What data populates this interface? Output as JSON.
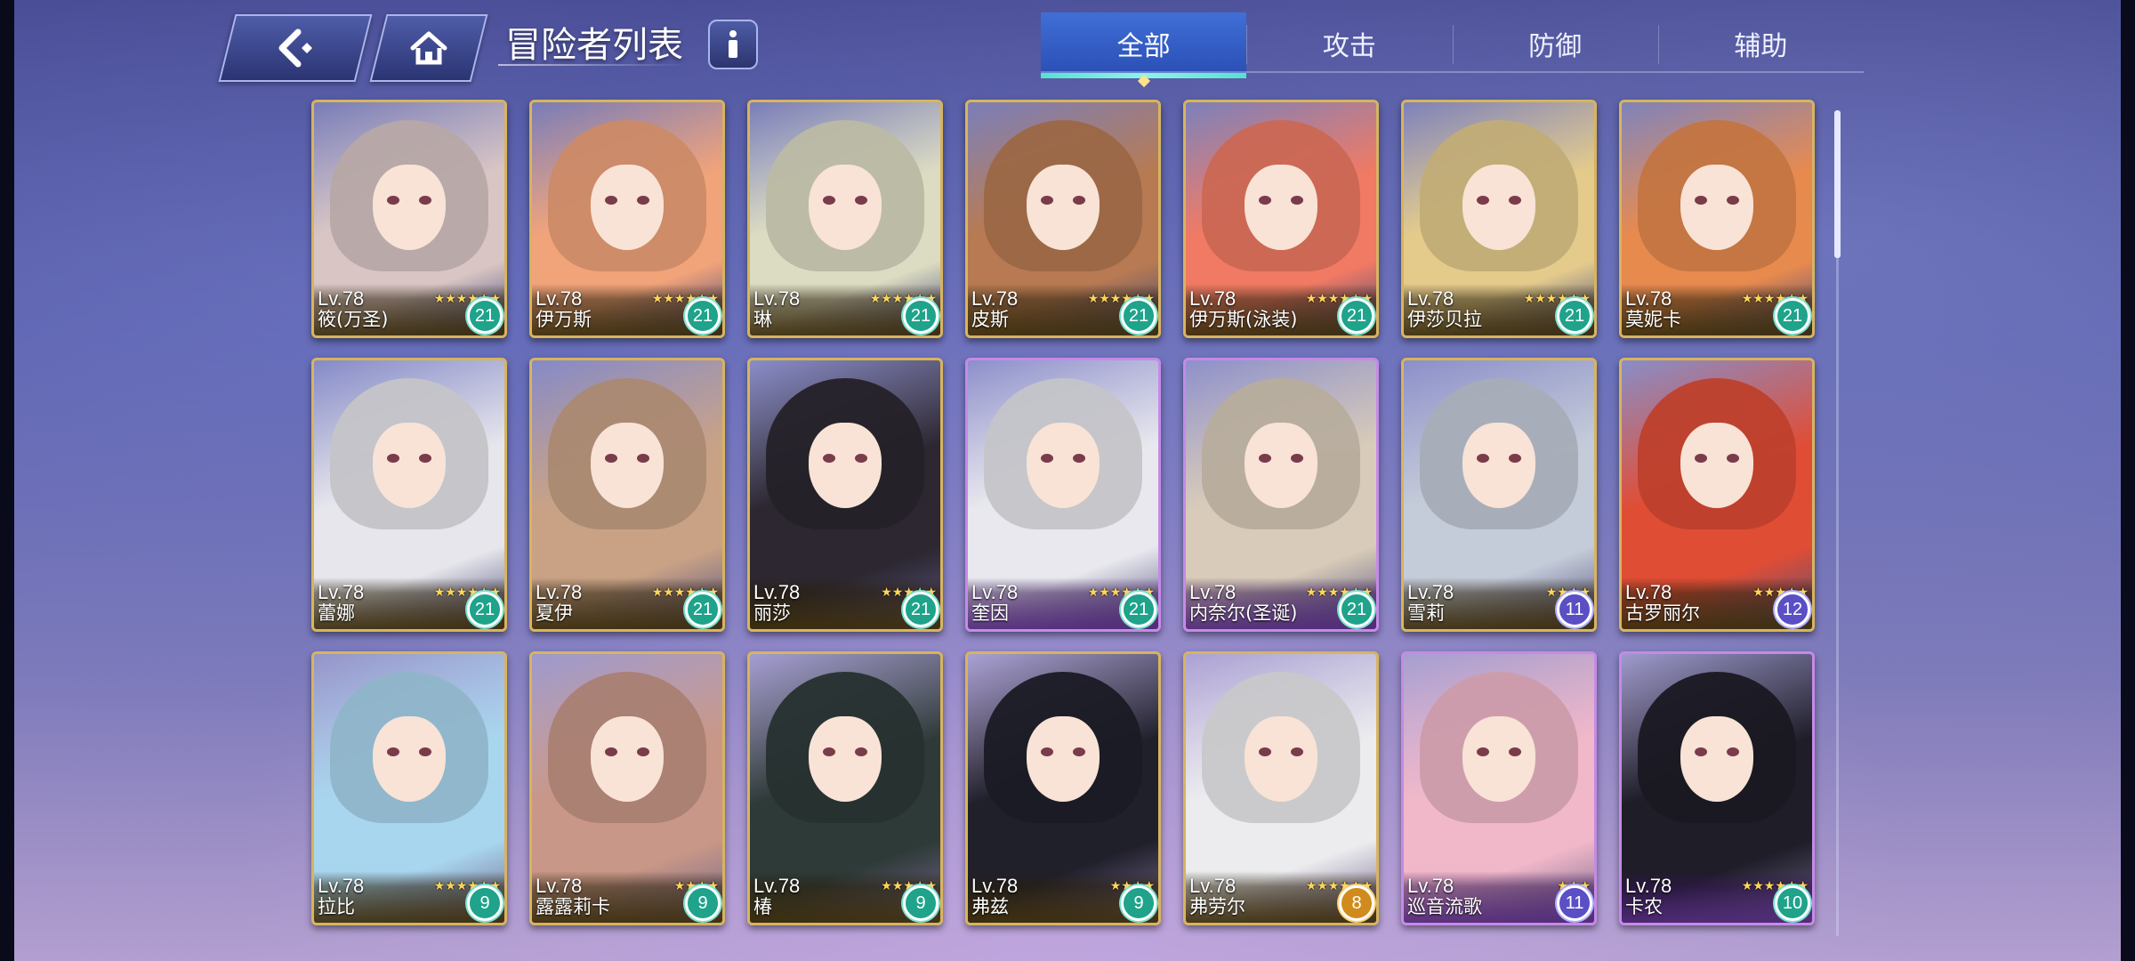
{
  "header": {
    "title": "冒险者列表",
    "back_icon": "back-arrow-icon",
    "home_icon": "home-icon",
    "info_icon": "info-icon"
  },
  "tabs": [
    {
      "label": "全部",
      "active": true
    },
    {
      "label": "攻击",
      "active": false
    },
    {
      "label": "防御",
      "active": false
    },
    {
      "label": "辅助",
      "active": false
    }
  ],
  "adventurers": [
    {
      "level": "Lv.78",
      "name": "筱(万圣)",
      "stars": 6,
      "count": "21",
      "rarity": "gold",
      "badge": "green",
      "color": "#d9c6c4"
    },
    {
      "level": "Lv.78",
      "name": "伊万斯",
      "stars": 6,
      "count": "21",
      "rarity": "gold",
      "badge": "green",
      "color": "#f1a37a"
    },
    {
      "level": "Lv.78",
      "name": "琳",
      "stars": 6,
      "count": "21",
      "rarity": "gold",
      "badge": "green",
      "color": "#dcdcc2"
    },
    {
      "level": "Lv.78",
      "name": "皮斯",
      "stars": 6,
      "count": "21",
      "rarity": "gold",
      "badge": "green",
      "color": "#b77a52"
    },
    {
      "level": "Lv.78",
      "name": "伊万斯(泳装)",
      "stars": 6,
      "count": "21",
      "rarity": "gold",
      "badge": "green",
      "color": "#f07a64"
    },
    {
      "level": "Lv.78",
      "name": "伊莎贝拉",
      "stars": 6,
      "count": "21",
      "rarity": "gold",
      "badge": "green",
      "color": "#e4cb8c"
    },
    {
      "level": "Lv.78",
      "name": "莫妮卡",
      "stars": 6,
      "count": "21",
      "rarity": "gold",
      "badge": "green",
      "color": "#e78a4e"
    },
    {
      "level": "Lv.78",
      "name": "蕾娜",
      "stars": 6,
      "count": "21",
      "rarity": "gold",
      "badge": "green",
      "color": "#e6e6ec"
    },
    {
      "level": "Lv.78",
      "name": "夏伊",
      "stars": 6,
      "count": "21",
      "rarity": "gold",
      "badge": "green",
      "color": "#c9a286"
    },
    {
      "level": "Lv.78",
      "name": "丽莎",
      "stars": 5,
      "count": "21",
      "rarity": "gold",
      "badge": "green",
      "color": "#2c2730"
    },
    {
      "level": "Lv.78",
      "name": "奎因",
      "stars": 6,
      "count": "21",
      "rarity": "purple",
      "badge": "green",
      "color": "#e8e8ee"
    },
    {
      "level": "Lv.78",
      "name": "内奈尔(圣诞)",
      "stars": 6,
      "count": "21",
      "rarity": "purple",
      "badge": "green",
      "color": "#d8cbb9"
    },
    {
      "level": "Lv.78",
      "name": "雪莉",
      "stars": 4,
      "count": "11",
      "rarity": "gold",
      "badge": "blue",
      "color": "#c5ccd9"
    },
    {
      "level": "Lv.78",
      "name": "古罗丽尔",
      "stars": 5,
      "count": "12",
      "rarity": "gold",
      "badge": "blue",
      "color": "#e04d35"
    },
    {
      "level": "Lv.78",
      "name": "拉比",
      "stars": 6,
      "count": "9",
      "rarity": "gold",
      "badge": "green",
      "color": "#a9d6ef"
    },
    {
      "level": "Lv.78",
      "name": "露露莉卡",
      "stars": 4,
      "count": "9",
      "rarity": "gold",
      "badge": "green",
      "color": "#c89787"
    },
    {
      "level": "Lv.78",
      "name": "椿",
      "stars": 5,
      "count": "9",
      "rarity": "gold",
      "badge": "green",
      "color": "#2e3a38"
    },
    {
      "level": "Lv.78",
      "name": "弗兹",
      "stars": 4,
      "count": "9",
      "rarity": "gold",
      "badge": "green",
      "color": "#20202b"
    },
    {
      "level": "Lv.78",
      "name": "弗劳尔",
      "stars": 6,
      "count": "8",
      "rarity": "gold",
      "badge": "orange",
      "color": "#ececef"
    },
    {
      "level": "Lv.78",
      "name": "巡音流歌",
      "stars": 3,
      "count": "11",
      "rarity": "purple",
      "badge": "blue",
      "color": "#f1b8c9"
    },
    {
      "level": "Lv.78",
      "name": "卡农",
      "stars": 6,
      "count": "10",
      "rarity": "purple",
      "badge": "green",
      "color": "#1e1d28"
    }
  ]
}
